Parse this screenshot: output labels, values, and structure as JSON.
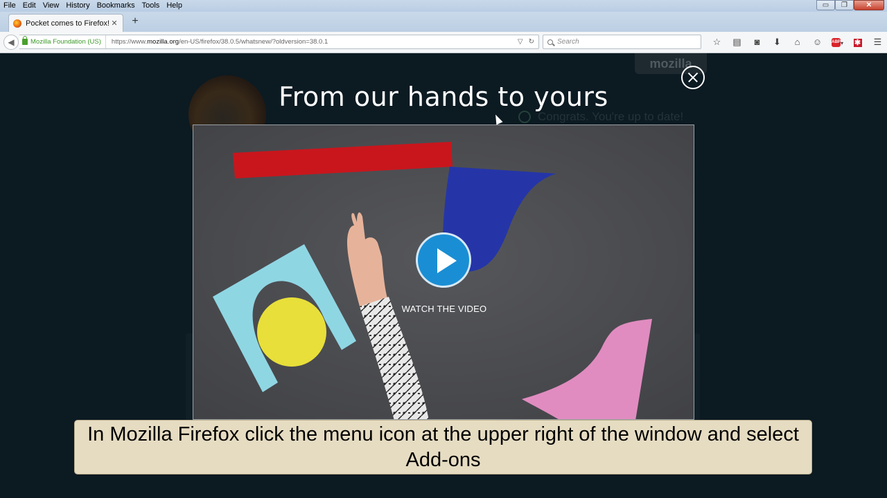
{
  "menubar": {
    "items": [
      "File",
      "Edit",
      "View",
      "History",
      "Bookmarks",
      "Tools",
      "Help"
    ]
  },
  "window_controls": {
    "minimize": "▭",
    "restore": "❐",
    "close": "✕"
  },
  "tabs": [
    {
      "title": "Pocket comes to Firefox! ...",
      "close": "✕"
    }
  ],
  "newtab_label": "+",
  "navbar": {
    "identity": "Mozilla Foundation (US)",
    "url_prefix": "https://www.",
    "url_domain": "mozilla.org",
    "url_path": "/en-US/firefox/38.0.5/whatsnew/?oldversion=38.0.1",
    "search_placeholder": "Search"
  },
  "toolbar": {
    "icons": [
      "bookmark-star-icon",
      "reading-list-icon",
      "pocket-icon",
      "download-icon",
      "home-icon",
      "chat-icon",
      "adblock-icon",
      "addon-red-icon",
      "hamburger-menu-icon"
    ],
    "abp_label": "ABP"
  },
  "page": {
    "mozilla_tab": "mozilla",
    "congrats": "Congrats. You're up to date!"
  },
  "modal": {
    "title": "From our hands to yours",
    "watch_label": "WATCH THE VIDEO"
  },
  "caption": {
    "text": "In Mozilla Firefox click the menu icon at the upper right of the window and select Add-ons"
  },
  "colors": {
    "play_button": "#1a8ed4",
    "caption_bg": "#e6dcc2",
    "page_bg": "#0c1a22"
  }
}
